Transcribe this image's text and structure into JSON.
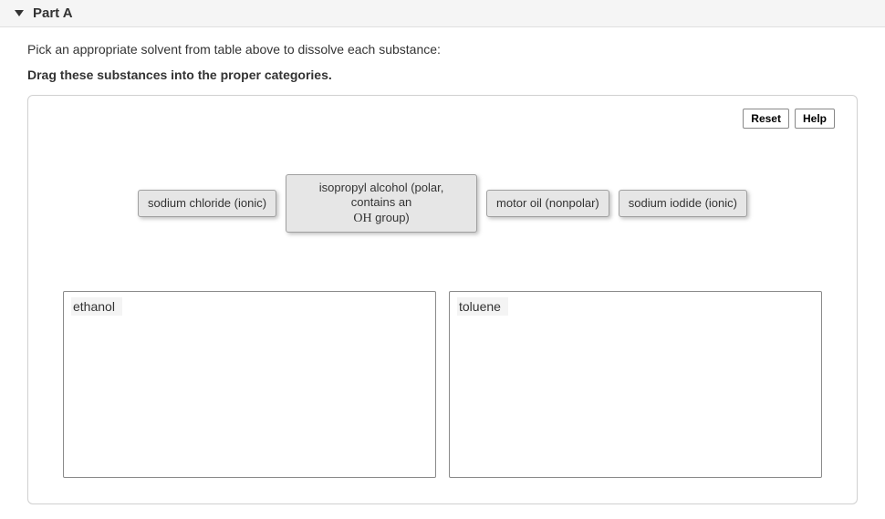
{
  "header": {
    "part_label": "Part A"
  },
  "prompt": "Pick an appropriate solvent from table above to dissolve each substance:",
  "instruction": "Drag these substances into the proper categories.",
  "buttons": {
    "reset": "Reset",
    "help": "Help"
  },
  "draggables": [
    "sodium chloride (ionic)",
    "isopropyl alcohol (polar, contains an OH group)",
    "motor oil (nonpolar)",
    "sodium iodide (ionic)"
  ],
  "chip2_pre": "isopropyl alcohol (polar, contains an",
  "chip2_chem": "OH",
  "chip2_post": " group)",
  "targets": {
    "left": "ethanol",
    "right": "toluene"
  }
}
